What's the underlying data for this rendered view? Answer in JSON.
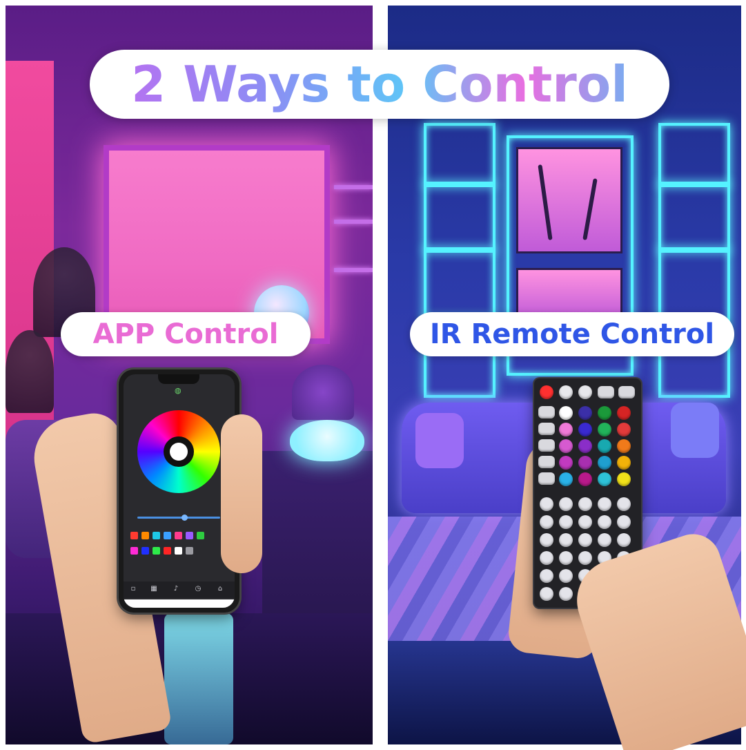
{
  "title": "2 Ways to Control",
  "left_label": "APP Control",
  "right_label": "IR Remote Control",
  "colors": {
    "left_label_text": "#e96bd4",
    "right_label_text": "#2f56e6",
    "title_gradient": [
      "#bf6cf0",
      "#5ec6f7",
      "#e86ee0"
    ],
    "neon_cyan": "#55f2ff",
    "neon_pink": "#f06bc3"
  },
  "icons": {
    "phone_bulb": "lightbulb-icon",
    "remote_power": "power-icon"
  }
}
